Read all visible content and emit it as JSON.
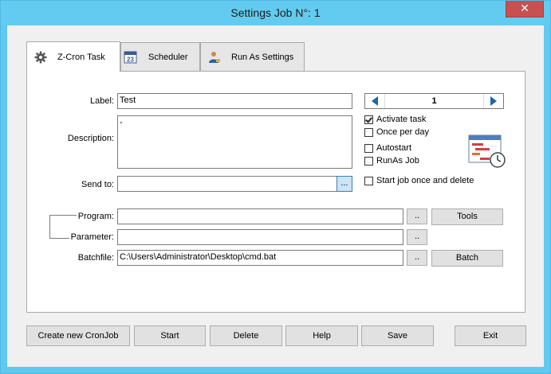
{
  "window": {
    "title": "Settings Job N°: 1",
    "close_glyph": "✕"
  },
  "tabs": [
    {
      "label": "Z-Cron Task",
      "icon": "gear-icon"
    },
    {
      "label": "Scheduler",
      "icon": "calendar-icon"
    },
    {
      "label": "Run As Settings",
      "icon": "user-icon"
    }
  ],
  "form": {
    "label_caption": "Label:",
    "label_value": "Test",
    "description_caption": "Description:",
    "description_value": "-",
    "sendto_caption": "Send to:",
    "sendto_value": "",
    "sendto_button": "...",
    "program_caption": "Program:",
    "program_value": "",
    "parameter_caption": "Parameter:",
    "parameter_value": "",
    "batchfile_caption": "Batchfile:",
    "batchfile_value": "C:\\Users\\Administrator\\Desktop\\cmd.bat",
    "browse_label": "..",
    "tools_button": "Tools",
    "batch_button": "Batch"
  },
  "job_spinner": {
    "value": "1"
  },
  "options": [
    {
      "label": "Activate task",
      "checked": true
    },
    {
      "label": "Once per day",
      "checked": false
    },
    {
      "label": "Autostart",
      "checked": false
    },
    {
      "label": "RunAs Job",
      "checked": false
    },
    {
      "label": "Start job once and delete",
      "checked": false
    }
  ],
  "footer": {
    "create": "Create new CronJob",
    "start": "Start",
    "delete": "Delete",
    "help": "Help",
    "save": "Save",
    "exit": "Exit"
  },
  "colors": {
    "titlebar": "#63cbf0",
    "close": "#c75050",
    "arrow": "#1a64b4"
  }
}
